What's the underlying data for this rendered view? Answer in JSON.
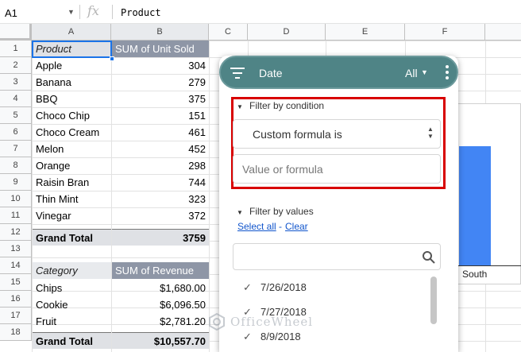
{
  "formula_bar": {
    "cell_ref": "A1",
    "fx_label": "fx",
    "content": "Product"
  },
  "columns": [
    "A",
    "B",
    "C",
    "D",
    "E",
    "F"
  ],
  "rows": [
    "1",
    "2",
    "3",
    "4",
    "5",
    "6",
    "7",
    "8",
    "9",
    "10",
    "11",
    "12",
    "13",
    "14",
    "15",
    "16",
    "17",
    "18"
  ],
  "pivot1": {
    "header_label": "Product",
    "header_value": "SUM of Unit Sold",
    "rows": [
      {
        "label": "Apple",
        "value": "304"
      },
      {
        "label": "Banana",
        "value": "279"
      },
      {
        "label": "BBQ",
        "value": "375"
      },
      {
        "label": "Choco Chip",
        "value": "151"
      },
      {
        "label": "Choco Cream",
        "value": "461"
      },
      {
        "label": "Melon",
        "value": "452"
      },
      {
        "label": "Orange",
        "value": "298"
      },
      {
        "label": "Raisin Bran",
        "value": "744"
      },
      {
        "label": "Thin Mint",
        "value": "323"
      },
      {
        "label": "Vinegar",
        "value": "372"
      }
    ],
    "total_label": "Grand Total",
    "total_value": "3759"
  },
  "pivot2": {
    "header_label": "Category",
    "header_value": "SUM of Revenue",
    "rows": [
      {
        "label": "Chips",
        "value": "$1,680.00"
      },
      {
        "label": "Cookie",
        "value": "$6,096.50"
      },
      {
        "label": "Fruit",
        "value": "$2,781.20"
      }
    ],
    "total_label": "Grand Total",
    "total_value": "$10,557.70"
  },
  "chart": {
    "category_label": "South",
    "bar_color": "#4285f4"
  },
  "filter_dialog": {
    "title": "Date",
    "status": "All",
    "header_color": "#4f8486",
    "condition_section": "Filter by condition",
    "condition_selected": "Custom formula is",
    "formula_placeholder": "Value or formula",
    "values_section": "Filter by values",
    "select_all": "Select all",
    "separator": "-",
    "clear": "Clear",
    "values": [
      "7/26/2018",
      "7/27/2018",
      "8/9/2018"
    ],
    "icons": [
      "filter-icon",
      "caret-down-icon",
      "more-vert-icon",
      "search-icon",
      "check-icon"
    ]
  },
  "watermark": "OfficeWheel"
}
